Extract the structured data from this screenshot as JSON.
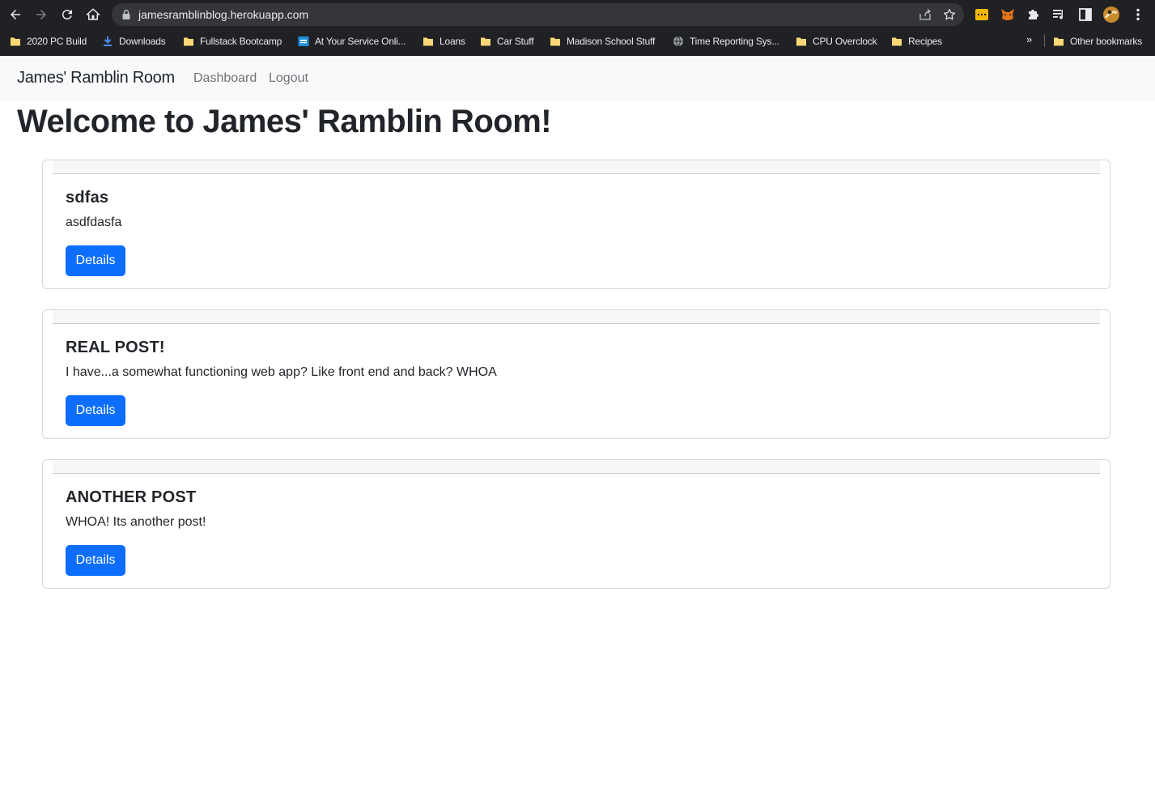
{
  "browser": {
    "url": "jamesramblinblog.herokuapp.com",
    "bookmarks": [
      {
        "label": "2020 PC Build",
        "icon": "folder-icon"
      },
      {
        "label": "Downloads",
        "icon": "download-icon"
      },
      {
        "label": "Fullstack Bootcamp",
        "icon": "folder-icon"
      },
      {
        "label": "At Your Service Onli...",
        "icon": "site-icon"
      },
      {
        "label": "Loans",
        "icon": "folder-icon"
      },
      {
        "label": "Car Stuff",
        "icon": "folder-icon"
      },
      {
        "label": "Madison School Stuff",
        "icon": "folder-icon"
      },
      {
        "label": "Time Reporting Sys...",
        "icon": "globe-icon"
      },
      {
        "label": "CPU Overclock",
        "icon": "folder-icon"
      },
      {
        "label": "Recipes",
        "icon": "folder-icon"
      }
    ],
    "overflow_label": "»",
    "other_bookmarks": "Other bookmarks",
    "colors": {
      "chrome": "#202124",
      "omnibox": "#35363a",
      "folder": "#f9d774"
    }
  },
  "navbar": {
    "brand": "James' Ramblin Room",
    "links": [
      "Dashboard",
      "Logout"
    ]
  },
  "page": {
    "heading": "Welcome to James' Ramblin Room!"
  },
  "posts": [
    {
      "title": "sdfas",
      "body": "asdfdasfa",
      "button": "Details"
    },
    {
      "title": "REAL POST!",
      "body": "I have...a somewhat functioning web app? Like front end and back? WHOA",
      "button": "Details"
    },
    {
      "title": "ANOTHER POST",
      "body": "WHOA! Its another post!",
      "button": "Details"
    }
  ],
  "colors": {
    "primary": "#0d6efd",
    "navbar_bg": "#f8f9fa",
    "text": "#212529"
  }
}
